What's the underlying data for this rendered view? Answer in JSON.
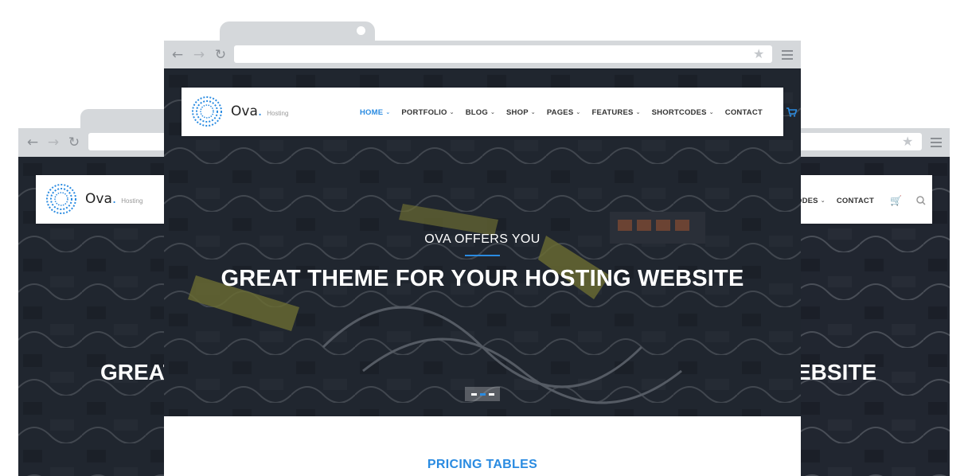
{
  "colors": {
    "accent": "#2a8be1",
    "chrome": "#d5d8db",
    "hero_overlay": "#1d222c"
  },
  "browser": {
    "back_icon": "arrow-left-icon",
    "forward_icon": "arrow-right-icon",
    "reload_icon": "reload-icon",
    "bookmark_icon": "star-icon",
    "menu_icon": "hamburger-icon"
  },
  "site": {
    "logo_name": "Ova",
    "logo_dot": ".",
    "logo_tag": "Hosting",
    "menu": [
      {
        "label": "HOME",
        "active": true,
        "has_dropdown": true
      },
      {
        "label": "PORTFOLIO",
        "active": false,
        "has_dropdown": true
      },
      {
        "label": "BLOG",
        "active": false,
        "has_dropdown": true
      },
      {
        "label": "SHOP",
        "active": false,
        "has_dropdown": true
      },
      {
        "label": "PAGES",
        "active": false,
        "has_dropdown": true
      },
      {
        "label": "FEATURES",
        "active": false,
        "has_dropdown": true
      },
      {
        "label": "SHORTCODES",
        "active": false,
        "has_dropdown": true
      },
      {
        "label": "CONTACT",
        "active": false,
        "has_dropdown": false
      }
    ],
    "back_menu_visible": {
      "partial": "ODES",
      "contact": "CONTACT"
    },
    "cart_icon": "cart-icon",
    "search_icon": "search-icon"
  },
  "hero": {
    "kicker": "OVA OFFERS YOU",
    "headline": "GREAT THEME FOR YOUR HOSTING WEBSITE",
    "left_fragment": "GREAT",
    "right_fragment": "EBSITE",
    "slider_dots": 3,
    "active_dot": 1
  },
  "section": {
    "pricing_title": "PRICING TABLES"
  }
}
